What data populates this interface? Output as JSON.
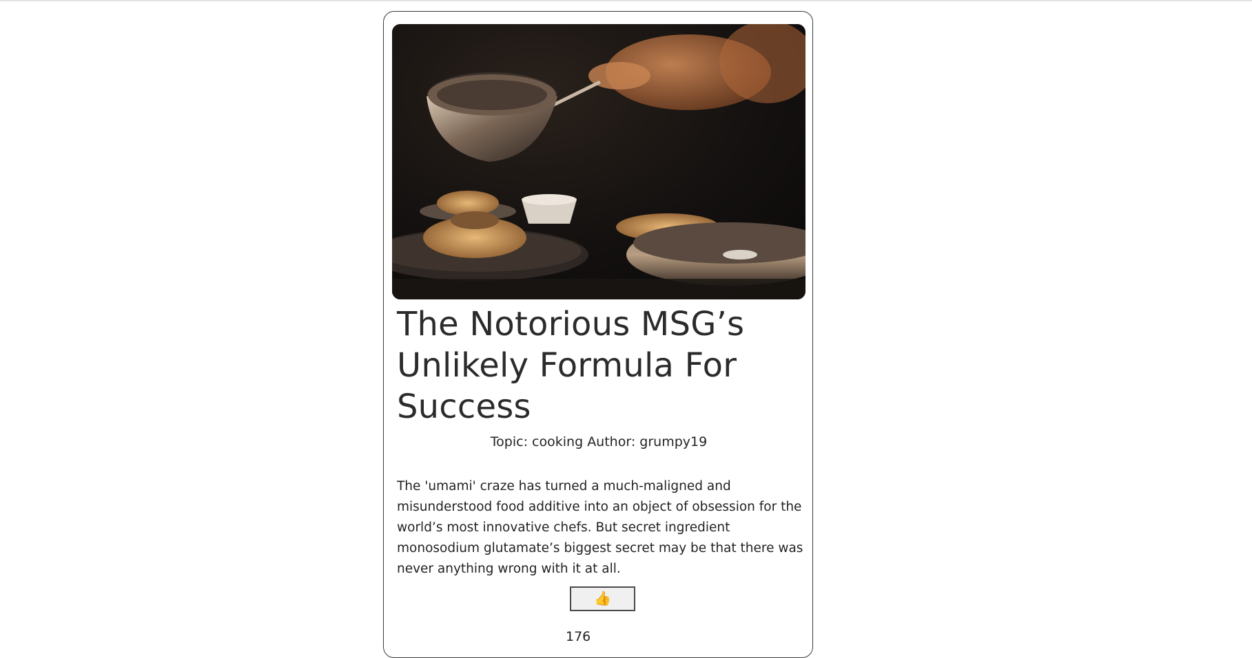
{
  "article": {
    "title": "The Notorious MSG’s Unlikely Formula For Success",
    "topic_label": "Topic:",
    "topic": "cooking",
    "author_label": "Author:",
    "author": "grumpy19",
    "description": "The 'umami' craze has turned a much-maligned and misunderstood food additive into an object of obsession for the world’s most innovative chefs. But secret ingredient monosodium glutamate’s biggest secret may be that there was never anything wrong with it at all.",
    "like_icon": "👍",
    "like_count": "176"
  },
  "colors": {
    "card_border": "#3a3a3a",
    "title_text": "#2b2b2b",
    "body_text": "#222222",
    "button_bg": "#f0f0f0"
  },
  "icons": {
    "like": "thumbs-up-icon",
    "hero": "cooking-photo"
  }
}
